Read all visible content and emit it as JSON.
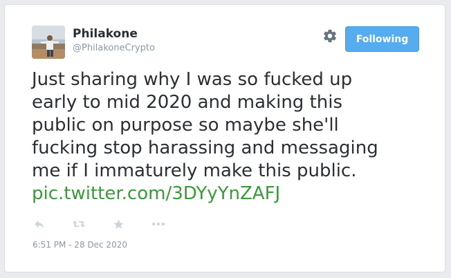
{
  "user": {
    "display_name": "Philakone",
    "handle": "@PhilakoneCrypto"
  },
  "follow_button": {
    "label": "Following"
  },
  "tweet": {
    "lines": [
      "Just sharing why I was so fucked up",
      "early to mid 2020 and making this",
      "public on purpose so maybe she'll",
      "fucking stop harassing and messaging",
      "me if I immaturely make this public."
    ],
    "link": "pic.twitter.com/3DYyYnZAFJ",
    "timestamp": "6:51 PM - 28 Dec 2020"
  },
  "icons": {
    "settings": "gear-icon",
    "reply": "reply-icon",
    "retweet": "retweet-icon",
    "like": "star-icon",
    "more": "more-icon"
  },
  "colors": {
    "accent": "#55acee",
    "link": "#3a9a3a",
    "text": "#292f33",
    "muted": "#8899a6",
    "icon": "#ccd6dd"
  }
}
